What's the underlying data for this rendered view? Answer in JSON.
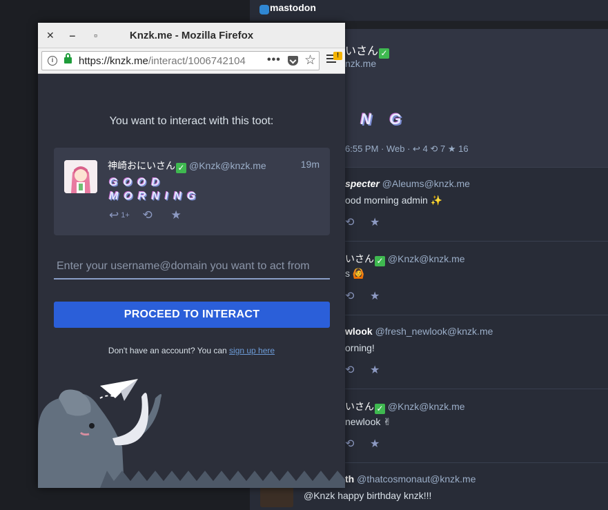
{
  "background": {
    "logo": "mastodon",
    "focused_status": {
      "name": "いさん",
      "handle": "nzk.me",
      "fancy": "I N G",
      "meta": "6:55 PM · Web ·",
      "replies": "4",
      "boosts": "7",
      "favs": "16"
    },
    "rows": [
      {
        "name": "specter",
        "handle": "@Aleums@knzk.me",
        "text": "ood morning admin ✨"
      },
      {
        "name": "いさん",
        "handle": "@Knzk@knzk.me",
        "text": "s 🙆"
      },
      {
        "name": "wlook",
        "handle": "@fresh_newlook@knzk.me",
        "text": "orning!"
      },
      {
        "name": "いさん",
        "handle": "@Knzk@knzk.me",
        "text": "newlook ✌"
      },
      {
        "name": "th",
        "handle": "@thatcosmonaut@knzk.me",
        "text": "@Knzk happy birthday knzk!!!"
      }
    ]
  },
  "window": {
    "title": "Knzk.me - Mozilla Firefox",
    "url_domain": "https://knzk.me",
    "url_path": "/interact/1006742104",
    "menu_badge": "!"
  },
  "page": {
    "prompt": "You want to interact with this toot:",
    "toot": {
      "name": "神崎おにいさん",
      "handle": "@Knzk@knzk.me",
      "time": "19m",
      "line1": "GOOD",
      "line2": "MORNING",
      "reply_count": "1+"
    },
    "input_placeholder": "Enter your username@domain you want to act from",
    "proceed_label": "PROCEED TO INTERACT",
    "signup_text": "Don't have an account? You can",
    "signup_link": "sign up here"
  }
}
